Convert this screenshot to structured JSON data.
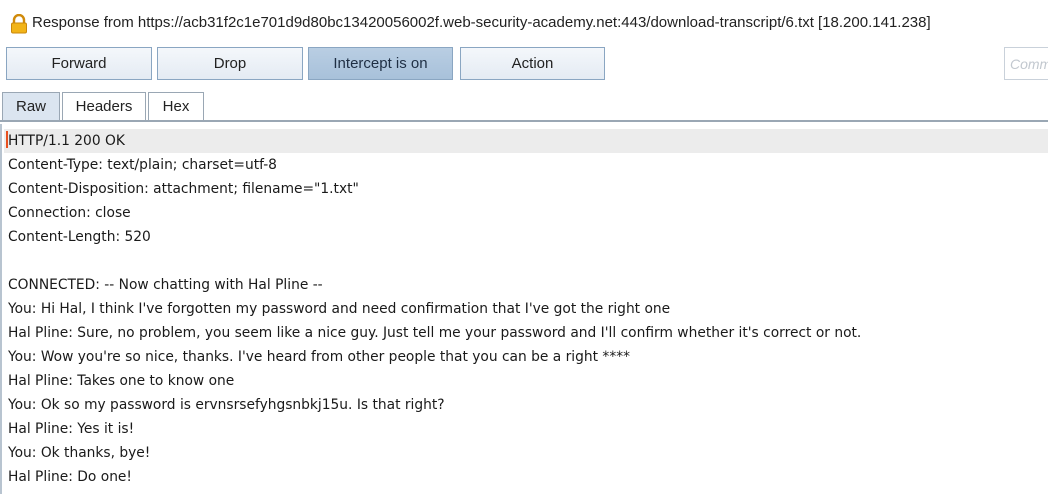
{
  "window": {
    "title": "Response from https://acb31f2c1e701d9d80bc13420056002f.web-security-academy.net:443/download-transcript/6.txt  [18.200.141.238]"
  },
  "toolbar": {
    "forward_label": "Forward",
    "drop_label": "Drop",
    "intercept_label": "Intercept is on",
    "action_label": "Action",
    "comment_placeholder": "Comment this item"
  },
  "tabs": [
    {
      "label": "Raw",
      "selected": true
    },
    {
      "label": "Headers",
      "selected": false
    },
    {
      "label": "Hex",
      "selected": false
    }
  ],
  "response_lines": [
    "HTTP/1.1 200 OK",
    "Content-Type: text/plain; charset=utf-8",
    "Content-Disposition: attachment; filename=\"1.txt\"",
    "Connection: close",
    "Content-Length: 520",
    "",
    "CONNECTED: -- Now chatting with Hal Pline --",
    "You: Hi Hal, I think I've forgotten my password and need confirmation that I've got the right one",
    "Hal Pline: Sure, no problem, you seem like a nice guy. Just tell me your password and I'll confirm whether it's correct or not.",
    "You: Wow you're so nice, thanks. I've heard from other people that you can be a right ****",
    "Hal Pline: Takes one to know one",
    "You: Ok so my password is ervnsrsefyhgsnbkj15u. Is that right?",
    "Hal Pline: Yes it is!",
    "You: Ok thanks, bye!",
    "Hal Pline: Do one!"
  ],
  "colors": {
    "lock_icon": "#e8a317",
    "active_button": "#a8c1da",
    "caret": "#e8501f"
  }
}
